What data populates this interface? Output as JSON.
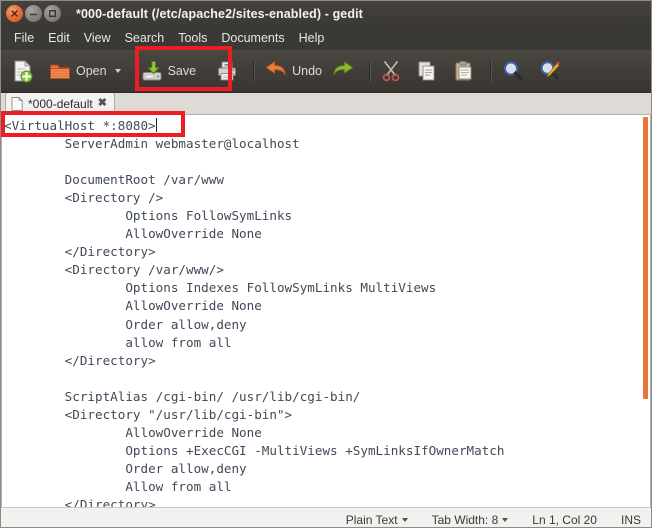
{
  "window": {
    "title": "*000-default (/etc/apache2/sites-enabled) - gedit",
    "controls": {
      "close": "close-button",
      "minimize": "minimize-button",
      "maximize": "maximize-button"
    }
  },
  "menubar": {
    "items": [
      {
        "label": "File"
      },
      {
        "label": "Edit"
      },
      {
        "label": "View"
      },
      {
        "label": "Search"
      },
      {
        "label": "Tools"
      },
      {
        "label": "Documents"
      },
      {
        "label": "Help"
      }
    ]
  },
  "toolbar": {
    "new_label": "",
    "open_label": "Open",
    "save_label": "Save",
    "print_label": "",
    "undo_label": "Undo",
    "redo_label": "",
    "cut_label": "",
    "copy_label": "",
    "paste_label": "",
    "find_label": "",
    "replace_label": ""
  },
  "tabs": [
    {
      "title": "*000-default",
      "close": "✖"
    }
  ],
  "editor": {
    "content": "<VirtualHost *:8080>\n\tServerAdmin webmaster@localhost\n\n\tDocumentRoot /var/www\n\t<Directory />\n\t\tOptions FollowSymLinks\n\t\tAllowOverride None\n\t</Directory>\n\t<Directory /var/www/>\n\t\tOptions Indexes FollowSymLinks MultiViews\n\t\tAllowOverride None\n\t\tOrder allow,deny\n\t\tallow from all\n\t</Directory>\n\n\tScriptAlias /cgi-bin/ /usr/lib/cgi-bin/\n\t<Directory \"/usr/lib/cgi-bin\">\n\t\tAllowOverride None\n\t\tOptions +ExecCGI -MultiViews +SymLinksIfOwnerMatch\n\t\tOrder allow,deny\n\t\tAllow from all\n\t</Directory>",
    "first_line": "<VirtualHost *:8080>",
    "rest": "\n\tServerAdmin webmaster@localhost\n\n\tDocumentRoot /var/www\n\t<Directory />\n\t\tOptions FollowSymLinks\n\t\tAllowOverride None\n\t</Directory>\n\t<Directory /var/www/>\n\t\tOptions Indexes FollowSymLinks MultiViews\n\t\tAllowOverride None\n\t\tOrder allow,deny\n\t\tallow from all\n\t</Directory>\n\n\tScriptAlias /cgi-bin/ /usr/lib/cgi-bin/\n\t<Directory \"/usr/lib/cgi-bin\">\n\t\tAllowOverride None\n\t\tOptions +ExecCGI -MultiViews +SymLinksIfOwnerMatch\n\t\tOrder allow,deny\n\t\tAllow from all\n\t</Directory>",
    "caret_line": 1,
    "caret_col": 20
  },
  "statusbar": {
    "language": "Plain Text",
    "tab_width": "Tab Width: 8",
    "position": "Ln 1, Col 20",
    "insert_mode": "INS"
  },
  "colors": {
    "titlebar": "#3b3935",
    "toolbar": "#403d38",
    "accent_scrollbar": "#e8763b",
    "annotation_red": "#ee1c25",
    "editor_text": "#3f4a58",
    "editor_bg": "#ffffff"
  },
  "annotations": [
    {
      "name": "save-button-highlight",
      "target": "Save"
    },
    {
      "name": "virtualhost-line-highlight",
      "target": "<VirtualHost *:8080>"
    }
  ]
}
